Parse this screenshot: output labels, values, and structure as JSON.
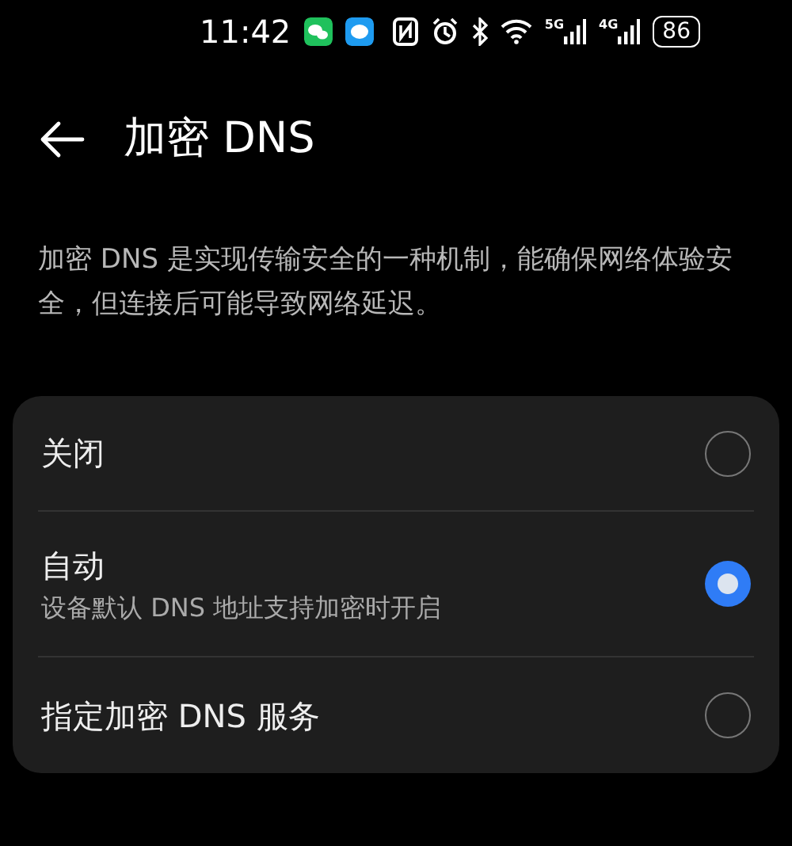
{
  "status_bar": {
    "time": "11:42",
    "networks": [
      "5G",
      "4G"
    ],
    "battery": "86"
  },
  "header": {
    "title": "加密 DNS"
  },
  "description": "加密 DNS 是实现传输安全的一种机制，能确保网络体验安全，但连接后可能导致网络延迟。",
  "options": [
    {
      "label": "关闭",
      "selected": false
    },
    {
      "label": "自动",
      "subtitle": "设备默认 DNS 地址支持加密时开启",
      "selected": true
    },
    {
      "label": "指定加密 DNS 服务",
      "selected": false
    }
  ]
}
